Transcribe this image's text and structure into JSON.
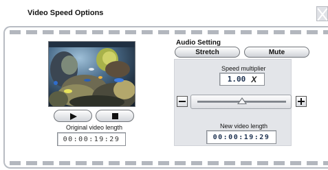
{
  "window": {
    "title": "Video Speed Options",
    "close_icon": "close-x-icon"
  },
  "preview": {
    "image_subject": "aquarium coral reef with tropical fish",
    "play_icon": "play-icon",
    "stop_icon": "stop-icon",
    "original_length_label": "Original video length",
    "original_length_value": "00:00:19:29"
  },
  "audio": {
    "section_title": "Audio Setting",
    "stretch_label": "Stretch",
    "mute_label": "Mute"
  },
  "speed": {
    "multiplier_label": "Speed multiplier",
    "multiplier_value": "1.00",
    "multiplier_suffix": "X",
    "slider_level": 0.5,
    "minus_icon": "minus-icon",
    "plus_icon": "plus-icon",
    "new_length_label": "New video length",
    "new_length_value": "00:00:19:29"
  },
  "colors": {
    "film_dash": "#b3b7be",
    "panel_bg": "#e3e5e9",
    "value_text": "#1d3150"
  }
}
